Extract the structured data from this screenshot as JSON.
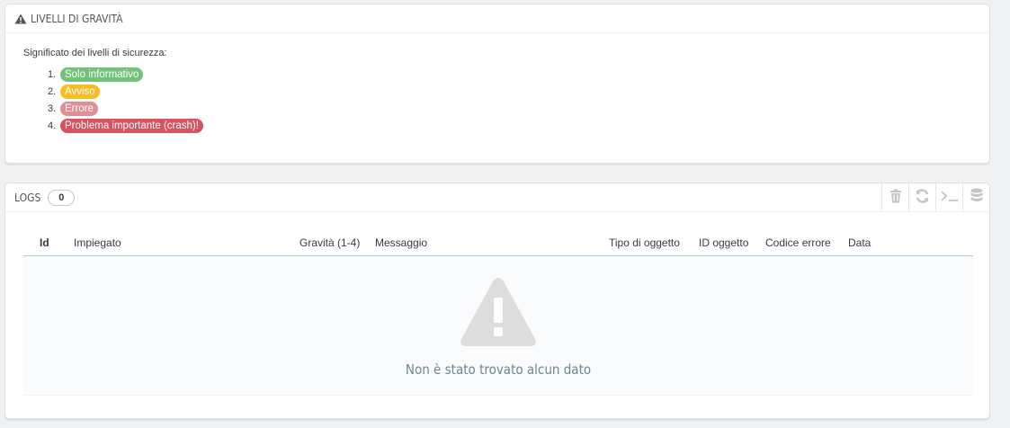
{
  "severity_panel": {
    "title": "LIVELLI DI GRAVITÀ",
    "intro": "Significato dei livelli di sicurezza:",
    "levels": [
      {
        "number": "1.",
        "label": "Solo informativo",
        "color": "#72c279"
      },
      {
        "number": "2.",
        "label": "Avviso",
        "color": "#fbbb22"
      },
      {
        "number": "3.",
        "label": "Errore",
        "color": "#e08f95"
      },
      {
        "number": "4.",
        "label": "Problema importante (crash)!",
        "color": "#d6535f"
      }
    ]
  },
  "logs_panel": {
    "title": "LOGS",
    "count": "0",
    "toolbar": [
      "trash-icon",
      "refresh-icon",
      "terminal-icon",
      "database-icon"
    ],
    "columns": {
      "id": "Id",
      "employee": "Impiegato",
      "severity": "Gravità (1-4)",
      "message": "Messaggio",
      "object_type": "Tipo di oggetto",
      "object_id": "ID oggetto",
      "error_code": "Codice errore",
      "date": "Data"
    },
    "empty_message": "Non è stato trovato alcun dato"
  },
  "colors": {
    "background": "#eff1f2",
    "panel_border": "#dbe0e3",
    "empty_icon": "#dddddd",
    "header_rule": "#a6cbd4"
  }
}
